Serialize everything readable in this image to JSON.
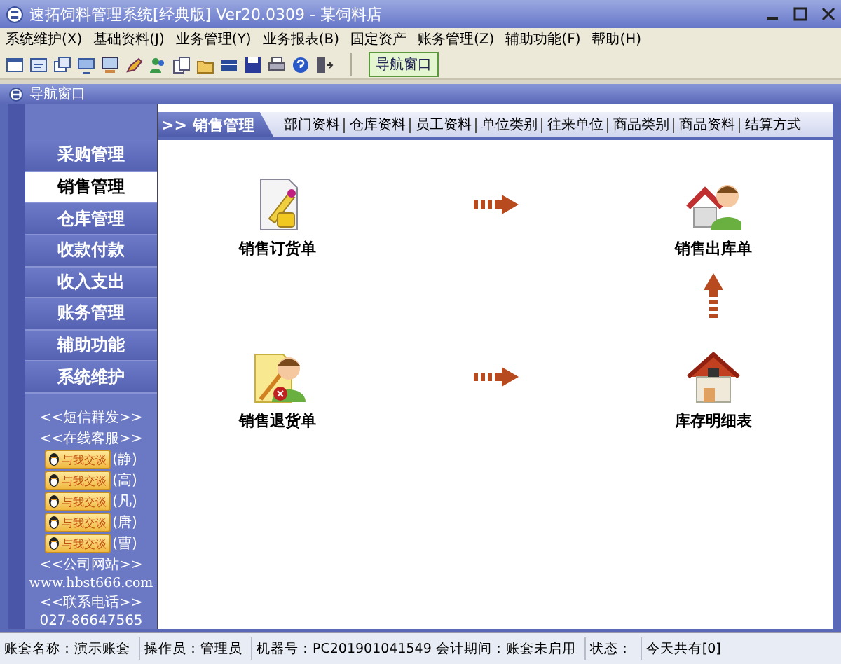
{
  "window": {
    "title": "速拓饲料管理系统[经典版] Ver20.0309 - 某饲料店"
  },
  "menu": [
    "系统维护(X)",
    "基础资料(J)",
    "业务管理(Y)",
    "业务报表(B)",
    "固定资产",
    "账务管理(Z)",
    "辅助功能(F)",
    "帮助(H)"
  ],
  "toolbar": {
    "nav_button": "导航窗口"
  },
  "subwindow": {
    "title": "导航窗口"
  },
  "sidebar": {
    "items": [
      {
        "label": "采购管理",
        "selected": false
      },
      {
        "label": "销售管理",
        "selected": true
      },
      {
        "label": "仓库管理",
        "selected": false
      },
      {
        "label": "收款付款",
        "selected": false
      },
      {
        "label": "收入支出",
        "selected": false
      },
      {
        "label": "账务管理",
        "selected": false
      },
      {
        "label": "辅助功能",
        "selected": false
      },
      {
        "label": "系统维护",
        "selected": false
      }
    ],
    "links_top": [
      "<<短信群发>>",
      "<<在线客服>>"
    ],
    "qq": [
      {
        "badge": "与我交谈",
        "name": "(静)"
      },
      {
        "badge": "与我交谈",
        "name": "(高)"
      },
      {
        "badge": "与我交谈",
        "name": "(凡)"
      },
      {
        "badge": "与我交谈",
        "name": "(唐)"
      },
      {
        "badge": "与我交谈",
        "name": "(曹)"
      }
    ],
    "website_label": "<<公司网站>>",
    "website": "www.hbst666.com",
    "phone_label": "<<联系电话>>",
    "phone": "027-86647565"
  },
  "panel": {
    "title": ">> 销售管理",
    "links": [
      "部门资料",
      "仓库资料",
      "员工资料",
      "单位类别",
      "往来单位",
      "商品类别",
      "商品资料",
      "结算方式"
    ]
  },
  "flow": {
    "nodes": [
      {
        "label": "销售订货单",
        "kind": "order"
      },
      {
        "label": "销售出库单",
        "kind": "outbound"
      },
      {
        "label": "销售退货单",
        "kind": "return"
      },
      {
        "label": "库存明细表",
        "kind": "stock"
      }
    ]
  },
  "status_bar": [
    "账套名称：演示账套",
    "操作员：管理员",
    "机器号：PC201901041549 会计期间：账套未启用",
    "状态：",
    "今天共有[0]"
  ]
}
